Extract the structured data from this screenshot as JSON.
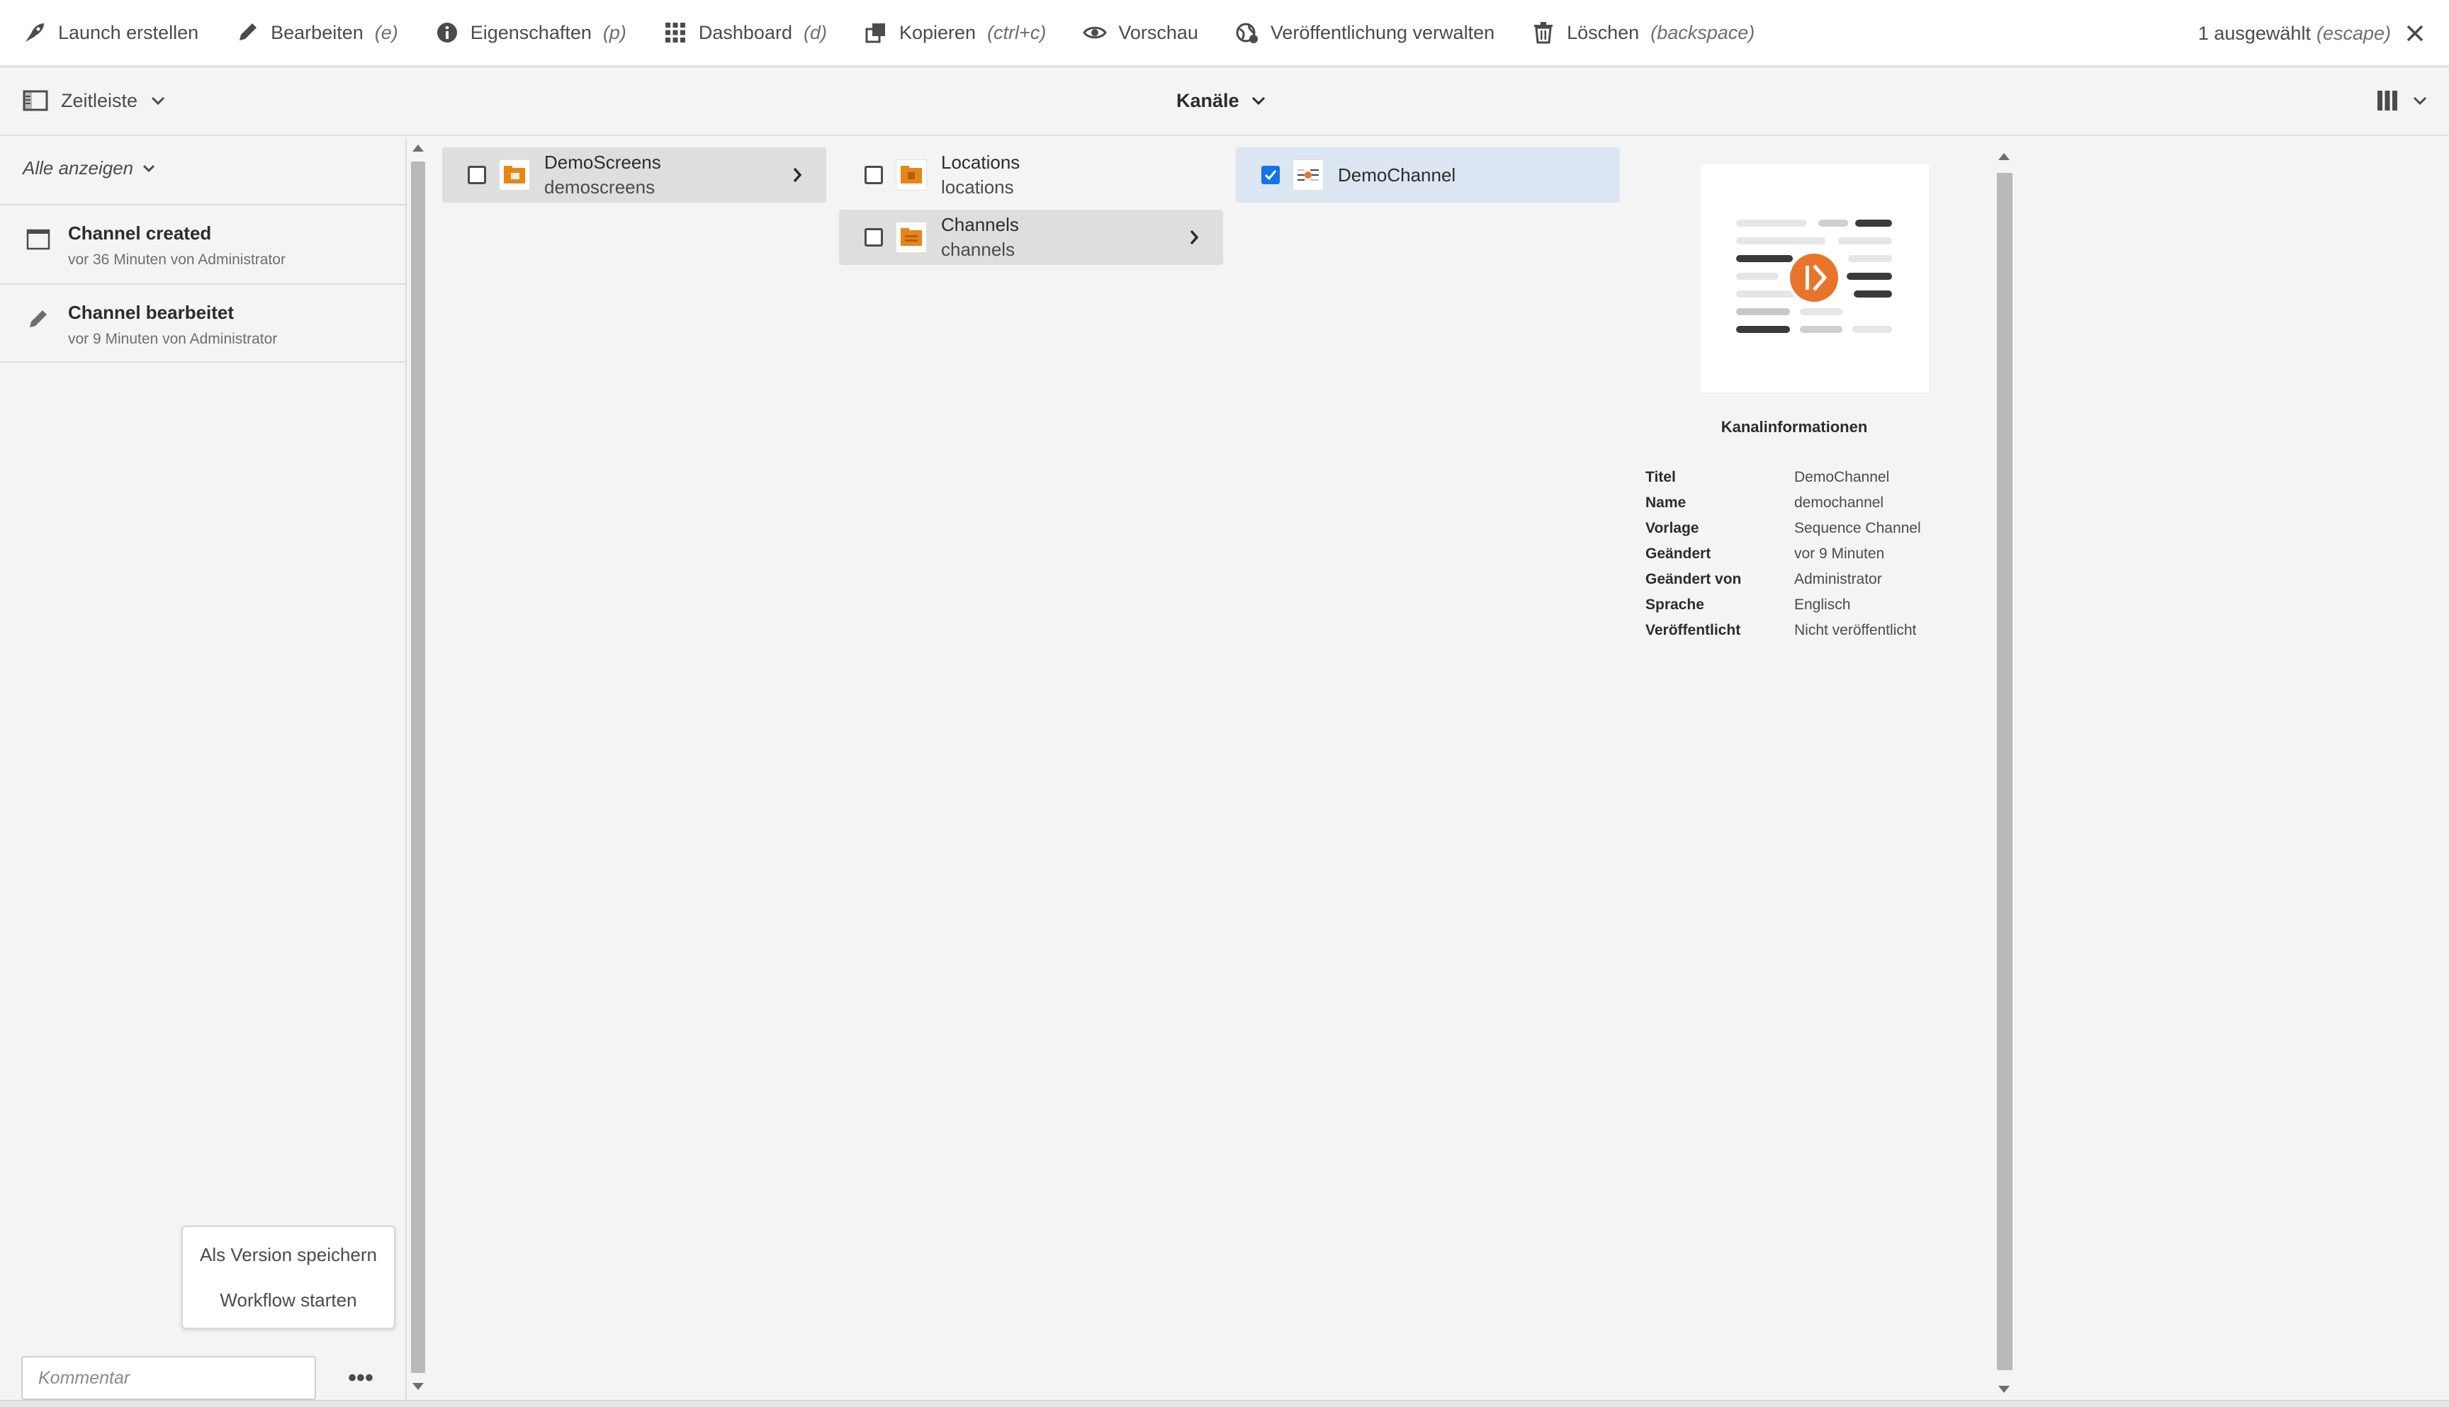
{
  "actionbar": {
    "actions": [
      {
        "label": "Launch erstellen",
        "hint": "",
        "icon": "rocket-icon"
      },
      {
        "label": "Bearbeiten",
        "hint": "(e)",
        "icon": "pencil-icon"
      },
      {
        "label": "Eigenschaften",
        "hint": "(p)",
        "icon": "info-icon"
      },
      {
        "label": "Dashboard",
        "hint": "(d)",
        "icon": "grid-icon"
      },
      {
        "label": "Kopieren",
        "hint": "(ctrl+c)",
        "icon": "copy-icon"
      },
      {
        "label": "Vorschau",
        "hint": "",
        "icon": "eye-icon"
      },
      {
        "label": "Veröffentlichung verwalten",
        "hint": "",
        "icon": "globe-icon"
      },
      {
        "label": "Löschen",
        "hint": "(backspace)",
        "icon": "trash-icon"
      }
    ],
    "selection": {
      "label": "1 ausgewählt",
      "hint": "(escape)"
    }
  },
  "subbar": {
    "rail_label": "Zeitleiste",
    "view_title": "Kanäle"
  },
  "timeline": {
    "filter_label": "Alle anzeigen",
    "events": [
      {
        "title": "Channel created",
        "meta": "vor 36 Minuten von Administrator",
        "icon": "calendar-icon"
      },
      {
        "title": "Channel bearbeitet",
        "meta": "vor 9 Minuten von Administrator",
        "icon": "pencil-icon"
      }
    ],
    "menu": [
      "Als Version speichern",
      "Workflow starten"
    ],
    "comment_placeholder": "Kommentar",
    "more_label": "•••"
  },
  "columns": {
    "col1": [
      {
        "title": "DemoScreens",
        "name": "demoscreens"
      }
    ],
    "col2": [
      {
        "title": "Locations",
        "name": "locations"
      },
      {
        "title": "Channels",
        "name": "channels"
      }
    ],
    "col3": [
      {
        "title": "DemoChannel"
      }
    ]
  },
  "preview": {
    "heading": "Kanalinformationen",
    "props": [
      {
        "k": "Titel",
        "v": "DemoChannel"
      },
      {
        "k": "Name",
        "v": "demochannel"
      },
      {
        "k": "Vorlage",
        "v": "Sequence Channel"
      },
      {
        "k": "Geändert",
        "v": "vor 9 Minuten"
      },
      {
        "k": "Geändert von",
        "v": "Administrator"
      },
      {
        "k": "Sprache",
        "v": "Englisch"
      },
      {
        "k": "Veröffentlicht",
        "v": "Nicht veröffentlicht"
      }
    ]
  },
  "colors": {
    "accent_blue": "#1473e6",
    "folder_orange": "#e68619",
    "channel_orange": "#e8742c",
    "selected_row": "#dce6f2"
  }
}
